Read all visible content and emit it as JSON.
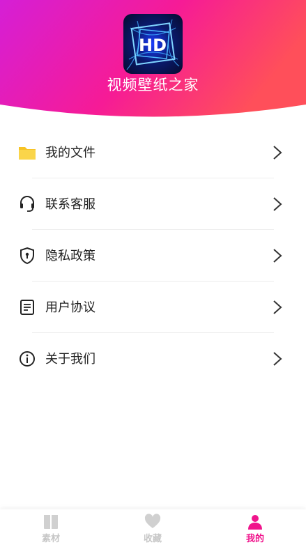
{
  "app": {
    "title": "视频壁纸之家",
    "logo_text": "HD"
  },
  "colors": {
    "gradient_start": "#d51fd6",
    "gradient_mid": "#f61b96",
    "gradient_end": "#ff4f5a",
    "active_tab": "#f0148c",
    "inactive_tab": "#c6c6c6",
    "folder_yellow": "#f7c325"
  },
  "menu": [
    {
      "label": "我的文件",
      "icon": "folder-icon"
    },
    {
      "label": "联系客服",
      "icon": "headset-icon"
    },
    {
      "label": "隐私政策",
      "icon": "shield-icon"
    },
    {
      "label": "用户协议",
      "icon": "document-icon"
    },
    {
      "label": "关于我们",
      "icon": "info-icon"
    }
  ],
  "tabs": [
    {
      "label": "素材",
      "icon": "box-icon",
      "active": false
    },
    {
      "label": "收藏",
      "icon": "heart-icon",
      "active": false
    },
    {
      "label": "我的",
      "icon": "user-icon",
      "active": true
    }
  ]
}
